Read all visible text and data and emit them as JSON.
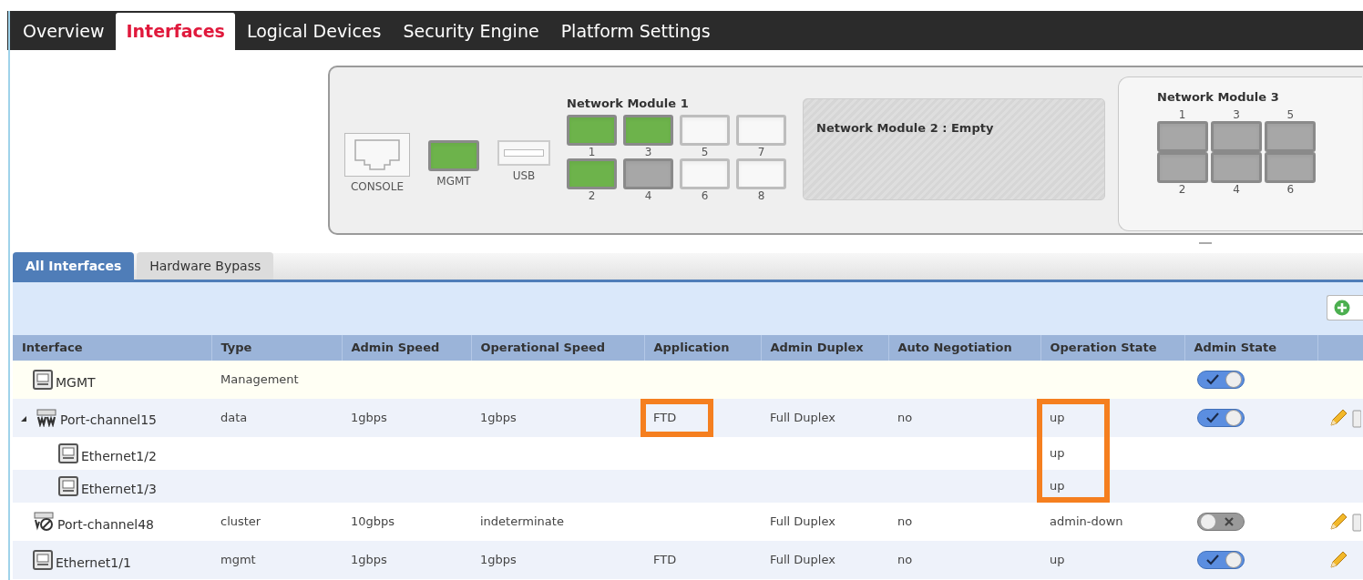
{
  "nav_tabs": [
    {
      "label": "Overview",
      "selected": false
    },
    {
      "label": "Interfaces",
      "selected": true
    },
    {
      "label": "Logical Devices",
      "selected": false
    },
    {
      "label": "Security Engine",
      "selected": false
    },
    {
      "label": "Platform Settings",
      "selected": false
    }
  ],
  "chassis": {
    "console": {
      "label": "CONSOLE"
    },
    "mgmt": {
      "label": "MGMT",
      "present": true,
      "connected": true
    },
    "usb": {
      "label": "USB"
    },
    "module_1": {
      "title": "Network Module 1",
      "ports": [
        {
          "label": "1",
          "present": true,
          "connected": true
        },
        {
          "label": "2",
          "present": true,
          "connected": true
        },
        {
          "label": "3",
          "present": true,
          "connected": true
        },
        {
          "label": "4",
          "present": true,
          "connected": false
        },
        {
          "label": "5",
          "present": false
        },
        {
          "label": "6",
          "present": false
        },
        {
          "label": "7",
          "present": false
        },
        {
          "label": "8",
          "present": false
        }
      ]
    },
    "module_2": {
      "title": "Network Module 2 : Empty"
    },
    "module_3": {
      "title": "Network Module 3",
      "ports": [
        {
          "label": "1",
          "present": true,
          "connected": false
        },
        {
          "label": "2",
          "present": true,
          "connected": false
        },
        {
          "label": "3",
          "present": true,
          "connected": false
        },
        {
          "label": "4",
          "present": true,
          "connected": false
        },
        {
          "label": "5",
          "present": true,
          "connected": false
        },
        {
          "label": "6",
          "present": true,
          "connected": false
        }
      ]
    }
  },
  "sub_tabs": [
    {
      "label": "All Interfaces",
      "selected": true
    },
    {
      "label": "Hardware Bypass",
      "selected": false
    }
  ],
  "table": {
    "columns": [
      "Interface",
      "Type",
      "Admin Speed",
      "Operational Speed",
      "Application",
      "Admin Duplex",
      "Auto Negotiation",
      "Operation State",
      "Admin State"
    ],
    "rows": [
      {
        "kind": "port",
        "interface": "MGMT",
        "type": "Management",
        "admin_state": true,
        "editable": false,
        "deletable": false,
        "application_highlighted": false,
        "operation_state_highlighted": false
      },
      {
        "kind": "port-channel",
        "interface": "Port-channel15",
        "expanded": true,
        "type": "data",
        "admin_speed": "1gbps",
        "operational_speed": "1gbps",
        "application": "FTD",
        "admin_duplex": "Full Duplex",
        "auto_negotiation": "no",
        "operation_state": "up",
        "admin_state": true,
        "editable": true,
        "deletable": true,
        "application_highlighted": true,
        "operation_state_highlighted": true,
        "children": [
          {
            "kind": "port",
            "interface": "Ethernet1/2",
            "operation_state": "up",
            "application_highlighted": false,
            "operation_state_highlighted": true
          },
          {
            "kind": "port",
            "interface": "Ethernet1/3",
            "operation_state": "up",
            "application_highlighted": false,
            "operation_state_highlighted": true
          }
        ]
      },
      {
        "kind": "cluster-channel",
        "interface": "Port-channel48",
        "type": "cluster",
        "admin_speed": "10gbps",
        "operational_speed": "indeterminate",
        "admin_duplex": "Full Duplex",
        "auto_negotiation": "no",
        "operation_state": "admin-down",
        "admin_state": false,
        "editable": true,
        "deletable": true,
        "application_highlighted": false,
        "operation_state_highlighted": false
      },
      {
        "kind": "port",
        "interface": "Ethernet1/1",
        "type": "mgmt",
        "admin_speed": "1gbps",
        "operational_speed": "1gbps",
        "application": "FTD",
        "admin_duplex": "Full Duplex",
        "auto_negotiation": "no",
        "operation_state": "up",
        "admin_state": true,
        "editable": true,
        "deletable": false,
        "application_highlighted": false,
        "operation_state_highlighted": false
      }
    ]
  }
}
